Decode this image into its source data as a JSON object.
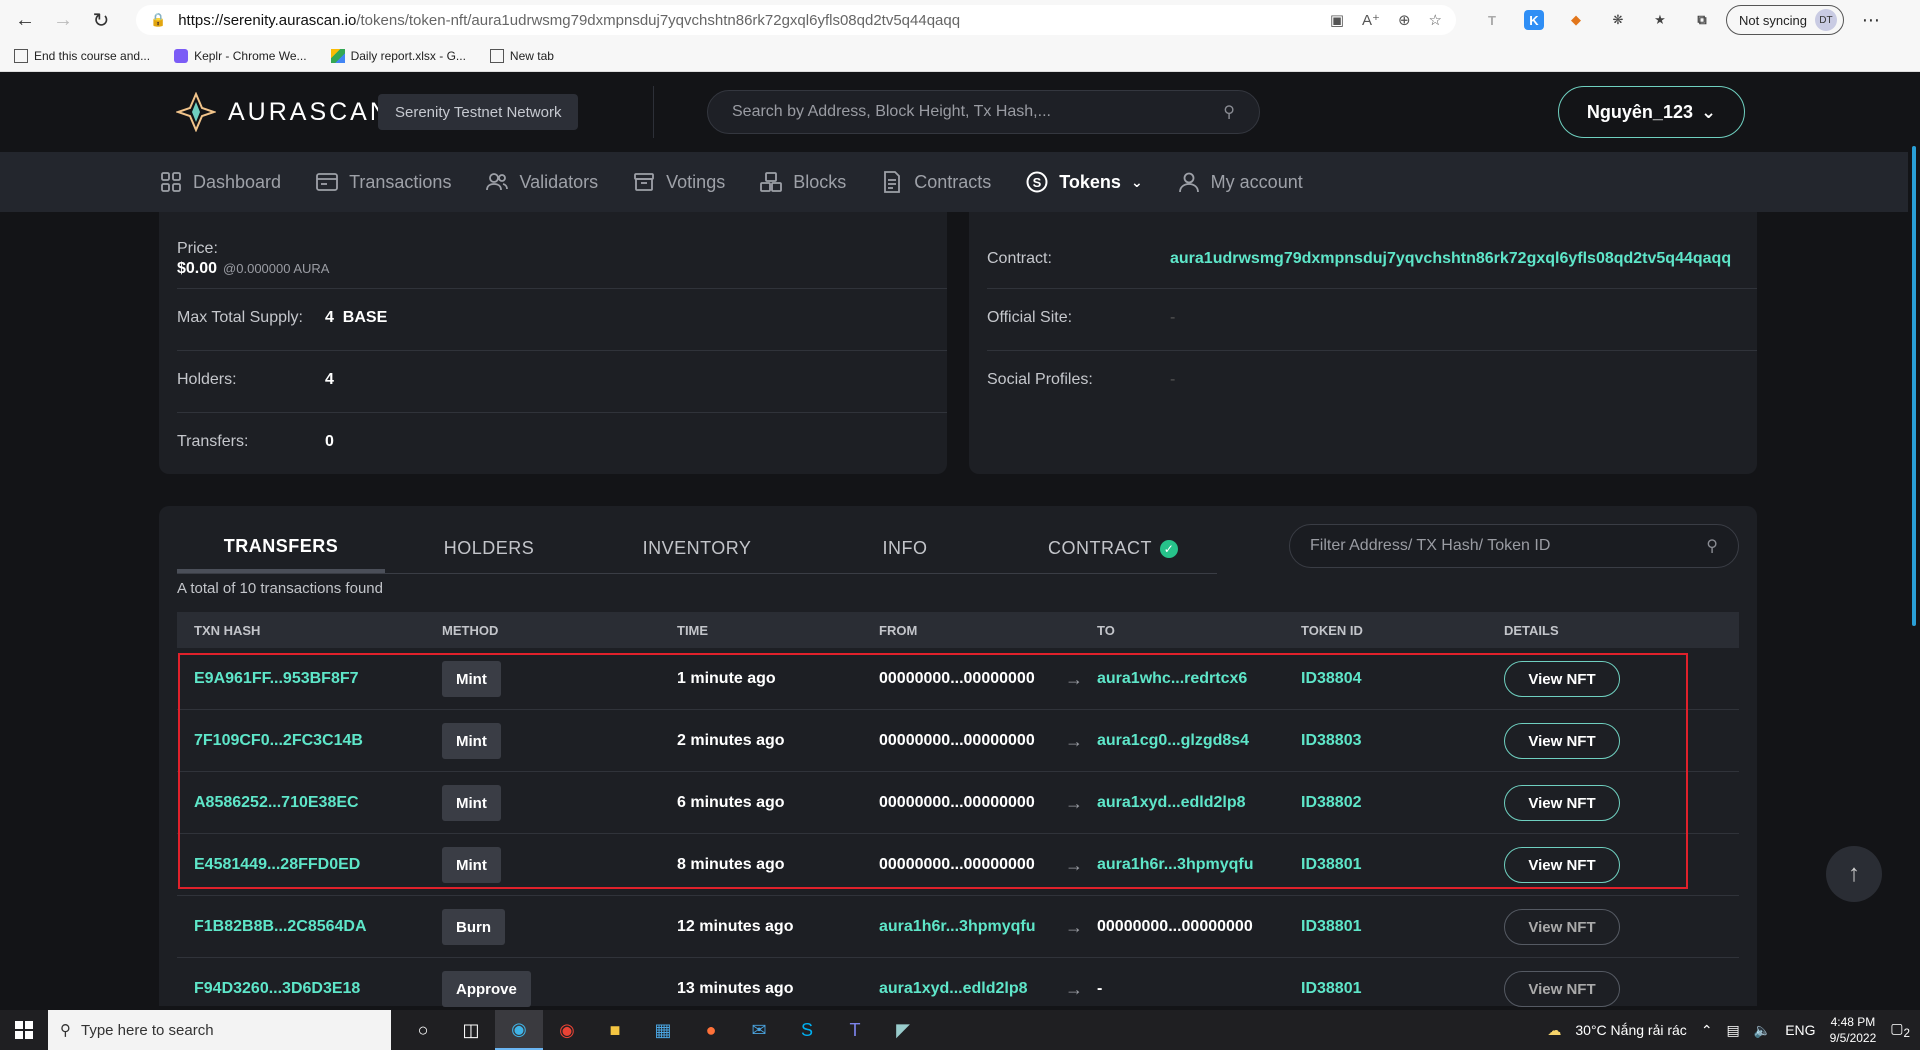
{
  "browser": {
    "url_host": "https://serenity.aurascan.io",
    "url_path": "/tokens/token-nft/aura1udrwsmg79dxmpnsduj7yqvchshtn86rk72gxql6yfls08qd2tv5q44qaqq",
    "sync_label": "Not syncing",
    "profile_initials": "DT",
    "bookmarks": [
      "End this course and...",
      "Keplr - Chrome We...",
      "Daily report.xlsx - G...",
      "New tab"
    ]
  },
  "header": {
    "logo_text": "AURASCAN",
    "network": "Serenity Testnet Network",
    "search_placeholder": "Search by Address, Block Height, Tx Hash,...",
    "account_name": "Nguyên_123"
  },
  "nav": {
    "items": [
      "Dashboard",
      "Transactions",
      "Validators",
      "Votings",
      "Blocks",
      "Contracts",
      "Tokens",
      "My account"
    ],
    "active": "Tokens"
  },
  "overview": {
    "price_label": "Price:",
    "price_value": "$0.00",
    "price_sub": "@0.000000 AURA",
    "supply_label": "Max Total Supply:",
    "supply_value": "4",
    "supply_unit": "BASE",
    "holders_label": "Holders:",
    "holders_value": "4",
    "transfers_label": "Transfers:",
    "transfers_value": "0",
    "contract_label": "Contract:",
    "contract_value": "aura1udrwsmg79dxmpnsduj7yqvchshtn86rk72gxql6yfls08qd2tv5q44qaqq",
    "site_label": "Official Site:",
    "site_value": "-",
    "social_label": "Social Profiles:",
    "social_value": "-"
  },
  "tabs": {
    "items": [
      "TRANSFERS",
      "HOLDERS",
      "INVENTORY",
      "INFO",
      "CONTRACT"
    ],
    "active": "TRANSFERS",
    "filter_placeholder": "Filter Address/ TX Hash/ Token ID"
  },
  "table": {
    "total_text": "A total of 10 transactions found",
    "headers": [
      "TXN HASH",
      "METHOD",
      "TIME",
      "FROM",
      "TO",
      "TOKEN ID",
      "DETAILS"
    ],
    "rows": [
      {
        "hash": "E9A961FF...953BF8F7",
        "method": "Mint",
        "time": "1 minute ago",
        "from": "00000000...00000000",
        "to": "aura1whc...redrtcx6",
        "token": "ID38804",
        "details": "View NFT"
      },
      {
        "hash": "7F109CF0...2FC3C14B",
        "method": "Mint",
        "time": "2 minutes ago",
        "from": "00000000...00000000",
        "to": "aura1cg0...glzgd8s4",
        "token": "ID38803",
        "details": "View NFT"
      },
      {
        "hash": "A8586252...710E38EC",
        "method": "Mint",
        "time": "6 minutes ago",
        "from": "00000000...00000000",
        "to": "aura1xyd...edld2lp8",
        "token": "ID38802",
        "details": "View NFT"
      },
      {
        "hash": "E4581449...28FFD0ED",
        "method": "Mint",
        "time": "8 minutes ago",
        "from": "00000000...00000000",
        "to": "aura1h6r...3hpmyqfu",
        "token": "ID38801",
        "details": "View NFT"
      },
      {
        "hash": "F1B82B8B...2C8564DA",
        "method": "Burn",
        "time": "12 minutes ago",
        "from": "aura1h6r...3hpmyqfu",
        "to": "00000000...00000000",
        "token": "ID38801",
        "details": "View NFT"
      },
      {
        "hash": "F94D3260...3D6D3E18",
        "method": "Approve",
        "time": "13 minutes ago",
        "from": "aura1xyd...edld2lp8",
        "to": "-",
        "token": "ID38801",
        "details": "View NFT"
      }
    ]
  },
  "taskbar": {
    "search_placeholder": "Type here to search",
    "weather": "30°C  Nắng rải rác",
    "lang": "ENG",
    "time": "4:48 PM",
    "date": "9/5/2022",
    "notif_count": "2"
  }
}
